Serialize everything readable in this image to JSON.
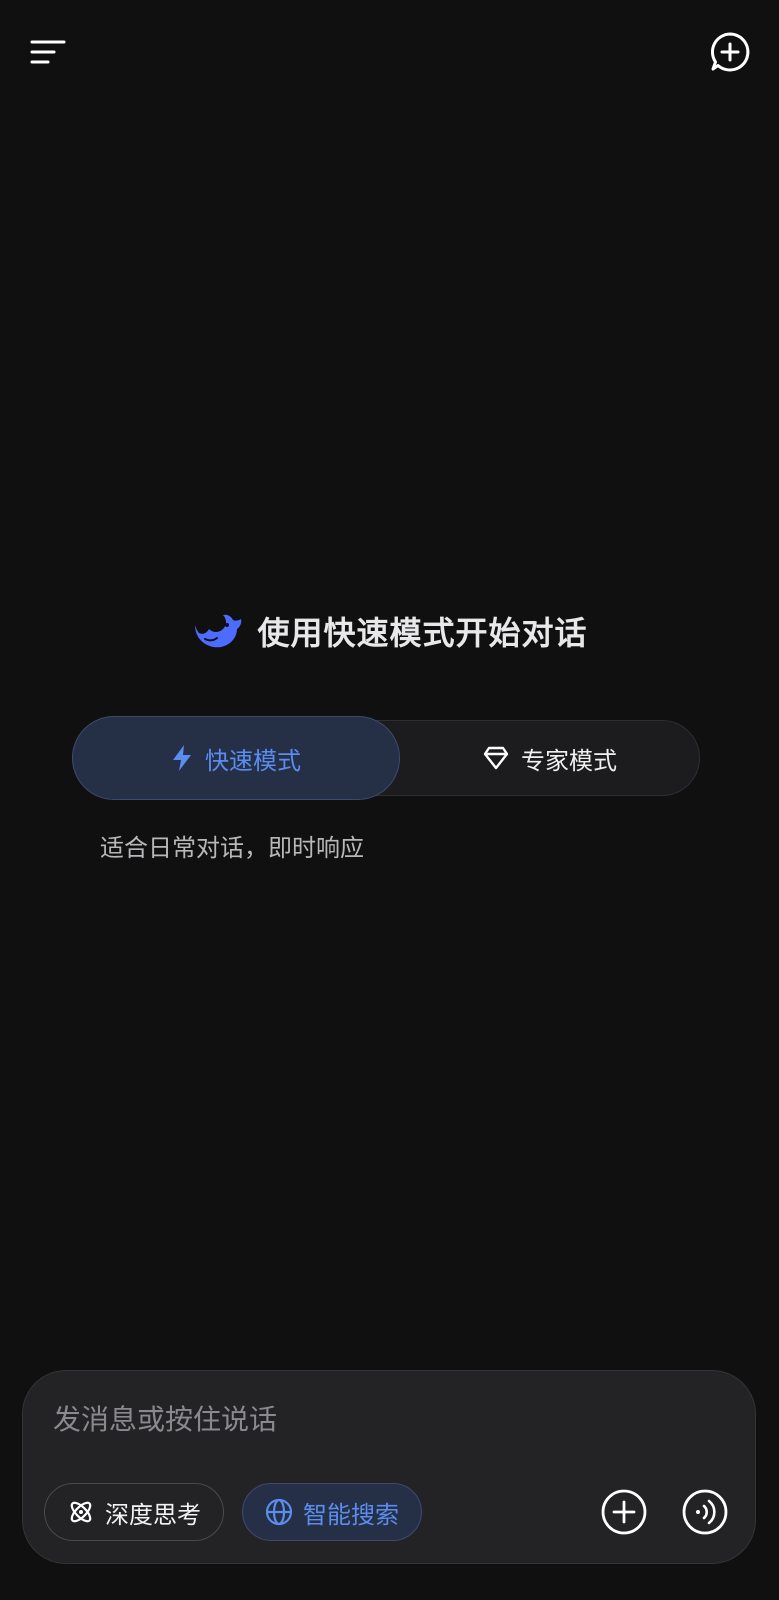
{
  "hero": {
    "title": "使用快速模式开始对话",
    "logo_icon": "deepseek-whale-icon"
  },
  "modes": {
    "fast_label": "快速模式",
    "expert_label": "专家模式",
    "selected": "fast",
    "description": "适合日常对话，即时响应"
  },
  "composer": {
    "placeholder": "发消息或按住说话",
    "value": "",
    "deep_think_label": "深度思考",
    "smart_search_label": "智能搜索"
  },
  "colors": {
    "background": "#101010",
    "accent": "#5b8cf0",
    "accent_bg": "#252f45"
  }
}
